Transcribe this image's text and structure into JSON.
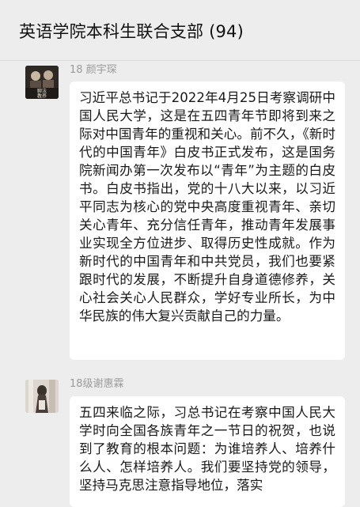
{
  "header": {
    "title": "英语学院本科生联合支部 (94)"
  },
  "messages": [
    {
      "sender": "18 颜宇琛",
      "avatar_text": "聊法\n教养",
      "text": "习近平总书记于2022年4月25日考察调研中国人民大学，这是在五四青年节即将到来之际对中国青年的重视和关心。前不久，《新时代的中国青年》白皮书正式发布，这是国务院新闻办第一次发布以“青年”为主题的白皮书。白皮书指出，党的十八大以来，以习近平同志为核心的党中央高度重视青年、亲切关心青年、充分信任青年，推动青年发展事业实现全方位进步、取得历史性成就。作为新时代的中国青年和中共党员，我们也要紧跟时代的发展，不断提升自身道德修养，关心社会关心人民群众，学好专业所长，为中华民族的伟大复兴贡献自己的力量。"
    },
    {
      "sender": "18级谢惠霖",
      "text": "五四来临之际，习总书记在考察中国人民大学时向全国各族青年之一节日的祝贺，也说到了教育的根本问题：为谁培养人、培养什么人、怎样培养人。我们要坚持党的领导，坚持马克思注意指导地位，落实"
    }
  ]
}
